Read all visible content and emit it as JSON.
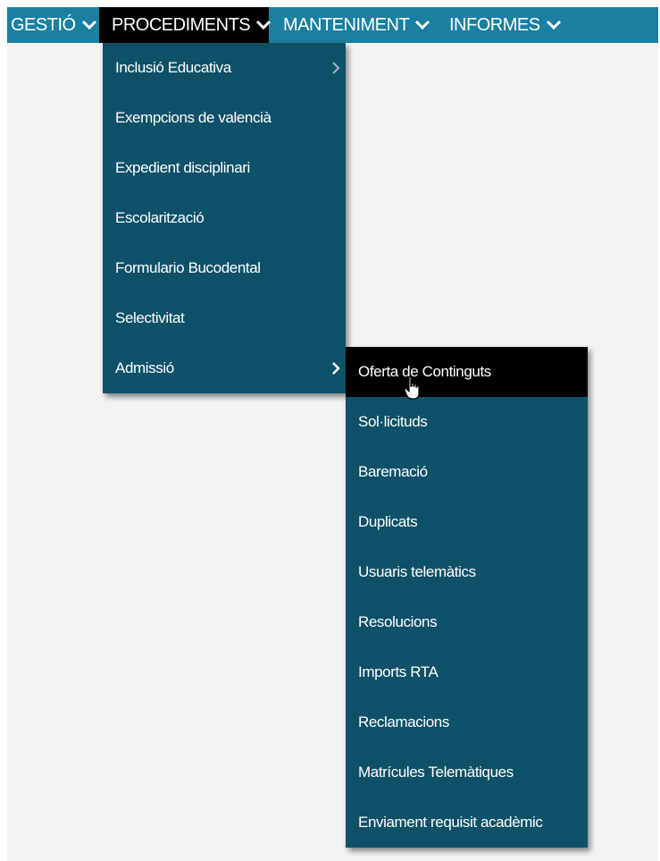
{
  "nav": {
    "items": [
      {
        "label": "GESTIÓ"
      },
      {
        "label": "PROCEDIMENTS"
      },
      {
        "label": "MANTENIMENT"
      },
      {
        "label": "INFORMES"
      }
    ]
  },
  "procediments_menu": {
    "items": [
      {
        "label": "Inclusió Educativa",
        "has_submenu": true
      },
      {
        "label": "Exempcions de valencià"
      },
      {
        "label": "Expedient disciplinari"
      },
      {
        "label": "Escolarització"
      },
      {
        "label": "Formulario Bucodental"
      },
      {
        "label": "Selectivitat"
      },
      {
        "label": "Admissió",
        "has_submenu": true
      }
    ]
  },
  "admissio_submenu": {
    "items": [
      {
        "label": "Oferta de Continguts"
      },
      {
        "label": "Sol·licituds"
      },
      {
        "label": "Baremació"
      },
      {
        "label": "Duplicats"
      },
      {
        "label": "Usuaris telemàtics"
      },
      {
        "label": "Resolucions"
      },
      {
        "label": "Imports RTA"
      },
      {
        "label": "Reclamacions"
      },
      {
        "label": "Matrícules Telemàtiques"
      },
      {
        "label": "Enviament requisit acadèmic"
      }
    ]
  },
  "colors": {
    "topbar": "#1a7fa0",
    "menu": "#0f5168",
    "active": "#000000",
    "background": "#f2f2f2"
  },
  "icons": [
    "chevron-down-icon",
    "chevron-right-icon",
    "hand-cursor-icon"
  ]
}
